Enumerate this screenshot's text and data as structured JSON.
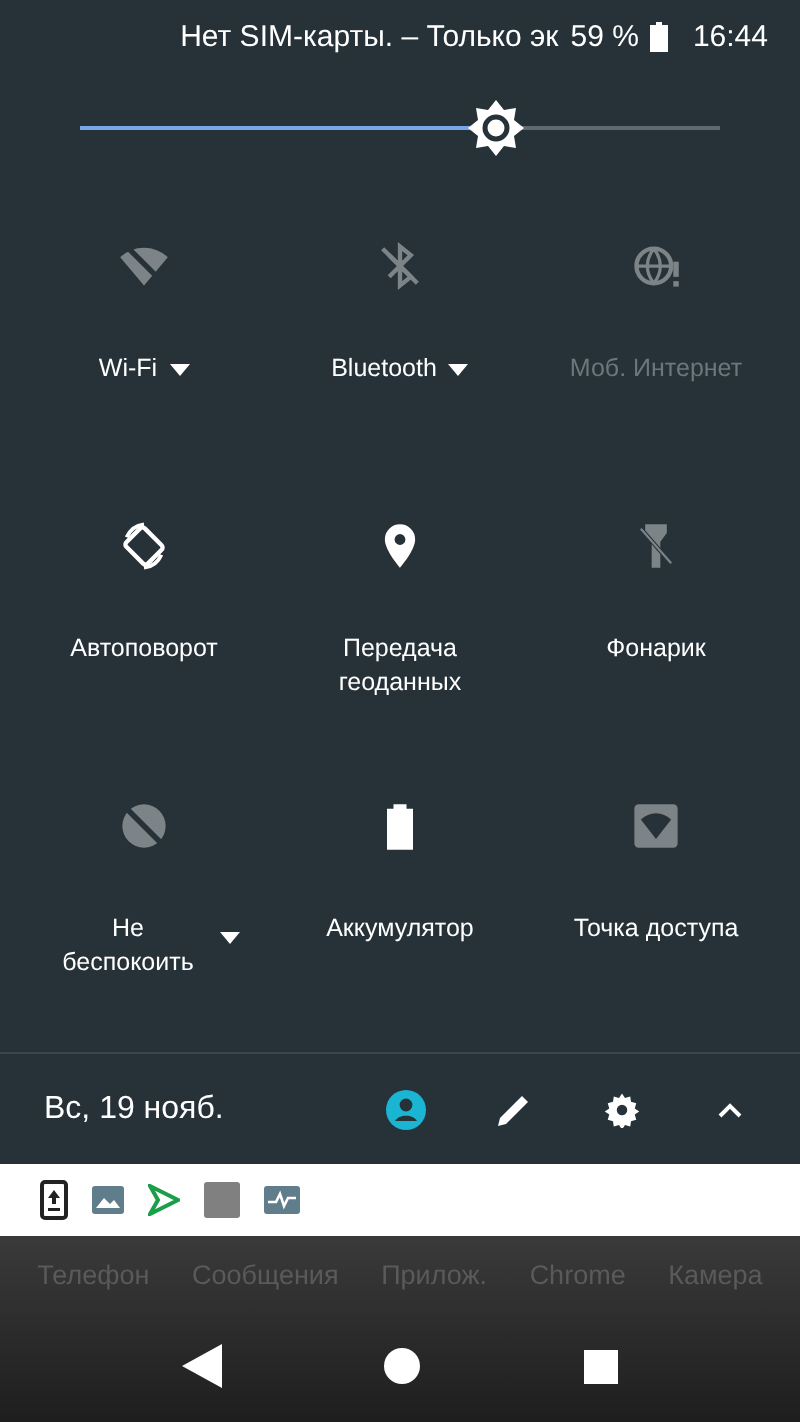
{
  "status_bar": {
    "carrier": "Нет SIM-карты. – Только эк",
    "battery": "59 %",
    "time": "16:44"
  },
  "brightness": {
    "level": 0.65
  },
  "tiles": [
    {
      "kind": "wifi",
      "label": "Wi-Fi",
      "on": false,
      "disabled": false,
      "dropdown": true
    },
    {
      "kind": "bluetooth",
      "label": "Bluetooth",
      "on": false,
      "disabled": false,
      "dropdown": true
    },
    {
      "kind": "data",
      "label": "Моб. Интернет",
      "on": false,
      "disabled": true,
      "dropdown": false
    },
    {
      "kind": "rotate",
      "label": "Автоповорот",
      "on": true,
      "disabled": false,
      "dropdown": false
    },
    {
      "kind": "location",
      "label": "Передача геоданных",
      "on": true,
      "disabled": false,
      "dropdown": false
    },
    {
      "kind": "flashlight",
      "label": "Фонарик",
      "on": false,
      "disabled": false,
      "dropdown": false
    },
    {
      "kind": "dnd",
      "label": "Не беспокоить",
      "on": false,
      "disabled": false,
      "dropdown": true
    },
    {
      "kind": "battery",
      "label": "Аккумулятор",
      "on": true,
      "disabled": false,
      "dropdown": false
    },
    {
      "kind": "hotspot",
      "label": "Точка доступа",
      "on": false,
      "disabled": false,
      "dropdown": false
    }
  ],
  "footer": {
    "date": "Вс, 19 нояб."
  },
  "notification_icons": [
    {
      "kind": "upload"
    },
    {
      "kind": "image"
    },
    {
      "kind": "play"
    },
    {
      "kind": "square"
    },
    {
      "kind": "pulse"
    }
  ],
  "dock": [
    "Телефон",
    "Сообщения",
    "Прилож.",
    "Chrome",
    "Камера"
  ]
}
